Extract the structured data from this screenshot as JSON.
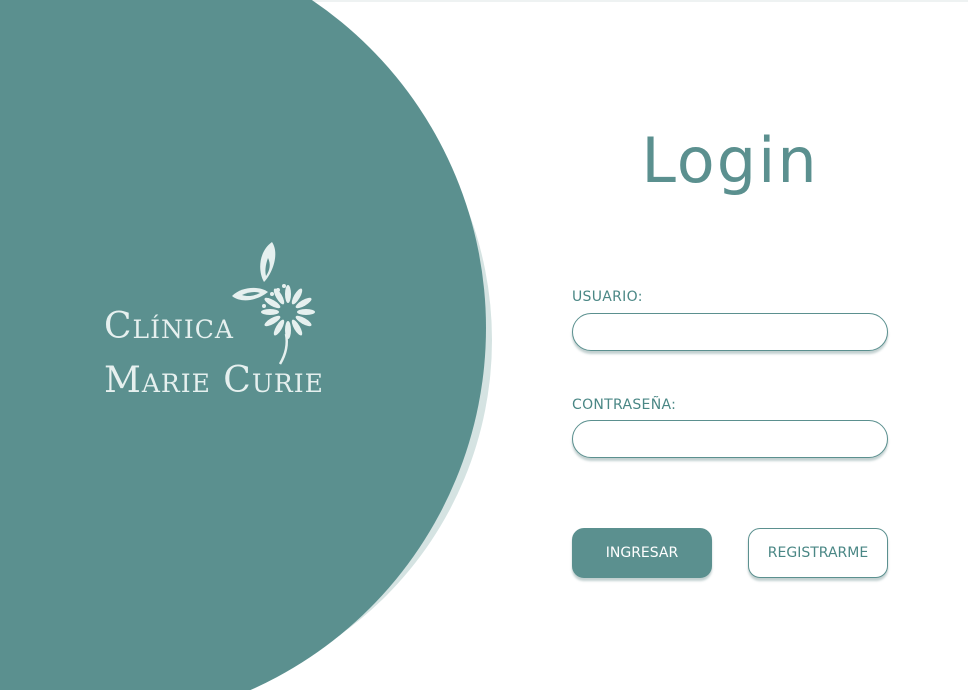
{
  "brand": {
    "name_line1": "Clínica",
    "name_line2": "Marie Curie",
    "logo_icon": "butterfly-daisy-icon"
  },
  "login": {
    "title": "Login",
    "username_label": "USUARIO:",
    "username_value": "",
    "password_label": "CONTRASEÑA:",
    "password_value": "",
    "submit_label": "INGRESAR",
    "register_label": "REGISTRARME"
  },
  "colors": {
    "primary": "#5b908f",
    "primary_light": "#d5e3e2",
    "label": "#4a8785",
    "background": "#ffffff"
  }
}
